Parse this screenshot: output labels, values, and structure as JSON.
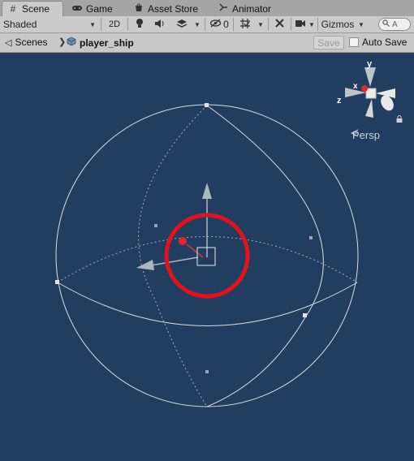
{
  "tabs": [
    {
      "label": "Scene",
      "icon": "grid-icon",
      "active": true
    },
    {
      "label": "Game",
      "icon": "gamepad-icon"
    },
    {
      "label": "Asset Store",
      "icon": "store-icon"
    },
    {
      "label": "Animator",
      "icon": "animator-icon"
    }
  ],
  "toolbar": {
    "shading_mode": "Shaded",
    "mode_2d": "2D",
    "hidden_count": "0",
    "gizmos_label": "Gizmos",
    "search_text": "A"
  },
  "breadcrumb": {
    "root_label": "Scenes",
    "current_label": "player_ship"
  },
  "prefab_bar": {
    "save_label": "Save",
    "auto_save_label": "Auto Save",
    "auto_save_checked": false
  },
  "orientation_gizmo": {
    "x_label": "x",
    "y_label": "y",
    "z_label": "z",
    "projection_label": "Persp"
  },
  "colors": {
    "viewport_bg": "#213e61",
    "highlight_circle": "#e3121b",
    "handle_arrow": "#aab8c0",
    "collider_wire": "#d8dde0"
  }
}
